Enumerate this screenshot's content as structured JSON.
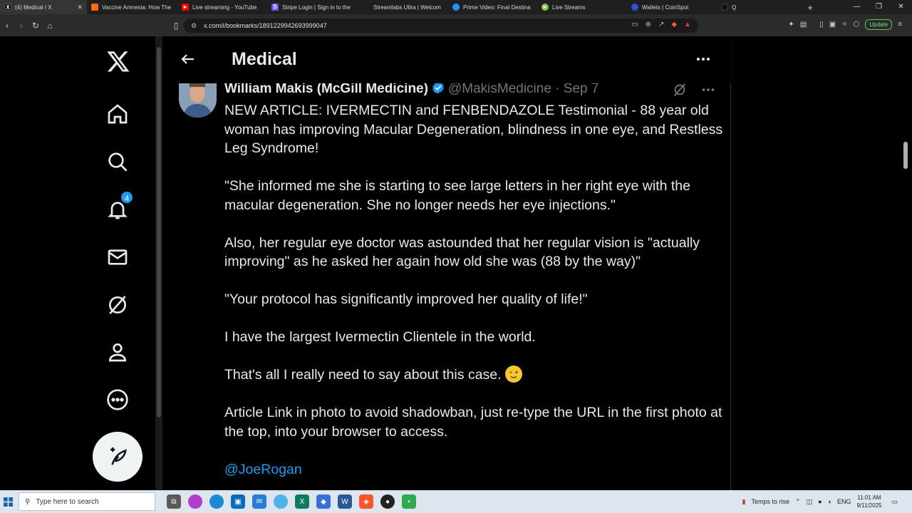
{
  "browser": {
    "tabs": [
      {
        "title": "(4) Medical / X",
        "active": true,
        "icon": "x-logo",
        "color": "#000000"
      },
      {
        "title": "Vaccine Amnesia: How The",
        "icon": "substack-logo",
        "color": "#ff6719"
      },
      {
        "title": "Live streaming - YouTube",
        "icon": "youtube-logo",
        "color": "#ff0000"
      },
      {
        "title": "Stripe Login | Sign in to the",
        "icon": "stripe-logo",
        "color": "#635bff"
      },
      {
        "title": "Streamlabs Ultra | Welcom",
        "icon": "streamlabs-logo",
        "color": "#1e1e1e"
      },
      {
        "title": "Prime Video: Final Destina",
        "icon": "prime-video-logo",
        "color": "#1a98ff"
      },
      {
        "title": "Live Streams",
        "icon": "rumble-logo",
        "color": "#85c742"
      },
      {
        "title": "Wallets | CoinSpot",
        "icon": "coinspot-logo",
        "color": "#2e4fd1"
      },
      {
        "title": "Q",
        "icon": "generic-logo",
        "color": "#111111"
      }
    ],
    "new_tab": "+",
    "url": "x.com/i/bookmarks/1891229942693999047",
    "update_label": "Update"
  },
  "sidebar": {
    "notification_count": "4"
  },
  "header": {
    "title": "Medical"
  },
  "tweet": {
    "author_name": "William Makis (McGill Medicine)",
    "handle_date": "@MakisMedicine · Sep 7",
    "paragraphs": [
      "NEW ARTICLE: IVERMECTIN and FENBENDAZOLE Testimonial - 88 year old woman has improving Macular Degeneration, blindness in one eye, and Restless Leg Syndrome!",
      "\"She informed me she is starting to see large letters in her right eye with the macular degeneration. She no longer needs her eye injections.\"",
      "Also, her regular eye doctor was astounded that her regular vision is \"actually improving\" as he asked her again how old she was (88 by the way)\"",
      "\"Your protocol has significantly improved her quality of life!\"",
      "I have the largest Ivermectin Clientele in the world.",
      "That's all I really need to say about this case.",
      "Article Link in photo to avoid shadowban, just re-type the URL in the first photo at the top, into your browser to access."
    ],
    "mention": "@JoeRogan"
  },
  "taskbar": {
    "search_placeholder": "Type here to search",
    "weather": "Temps to rise",
    "language": "ENG",
    "time": "11:01 AM",
    "date": "9/11/2025"
  },
  "colors": {
    "accent": "#1d9bf0",
    "text": "#e7e9ea",
    "muted": "#71767b"
  }
}
